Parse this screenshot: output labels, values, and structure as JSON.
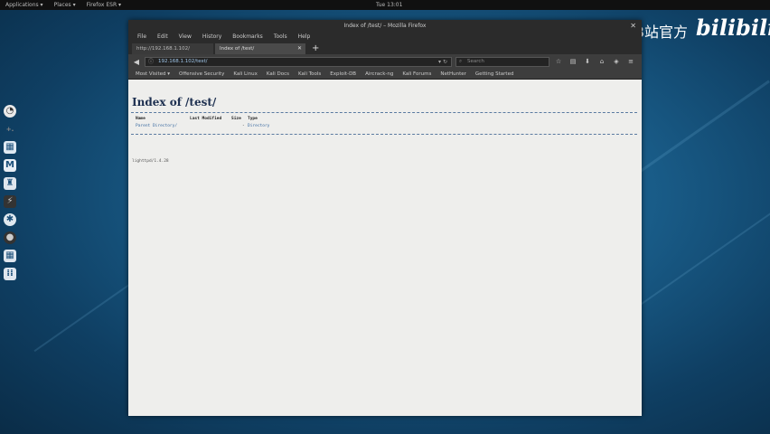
{
  "topbar": {
    "applications": "Applications ▾",
    "places": "Places ▾",
    "app_name": "Firefox ESR ▾",
    "clock": "Tue 13:01"
  },
  "watermark": {
    "text": "网络安全B站官方",
    "logo": "bilibili"
  },
  "dock": {
    "icons": [
      "firefox-icon",
      "terminal-icon",
      "metasploit-icon",
      "armitage-icon",
      "burpsuite-icon",
      "maltego-icon",
      "faraday-icon",
      "cherrytree-icon",
      "apps-grid-icon"
    ]
  },
  "window": {
    "title": "Index of /test/ – Mozilla Firefox",
    "menu": [
      "File",
      "Edit",
      "View",
      "History",
      "Bookmarks",
      "Tools",
      "Help"
    ],
    "tabs": [
      {
        "label": "http://192.168.1.102/",
        "active": false
      },
      {
        "label": "Index of /test/",
        "active": true
      }
    ],
    "url": "192.168.1.102/test/",
    "search_placeholder": "Search",
    "bookmarks": [
      "Most Visited ▾",
      "Offensive Security",
      "Kali Linux",
      "Kali Docs",
      "Kali Tools",
      "Exploit-DB",
      "Aircrack-ng",
      "Kali Forums",
      "NetHunter",
      "Getting Started"
    ]
  },
  "page": {
    "heading": "Index of /test/",
    "columns": [
      "Name",
      "Last Modified",
      "Size",
      "Type"
    ],
    "rows": [
      {
        "name": "Parent Directory/",
        "modified": "",
        "size": "-",
        "type": "Directory"
      }
    ],
    "footer": "lighttpd/1.4.28"
  }
}
